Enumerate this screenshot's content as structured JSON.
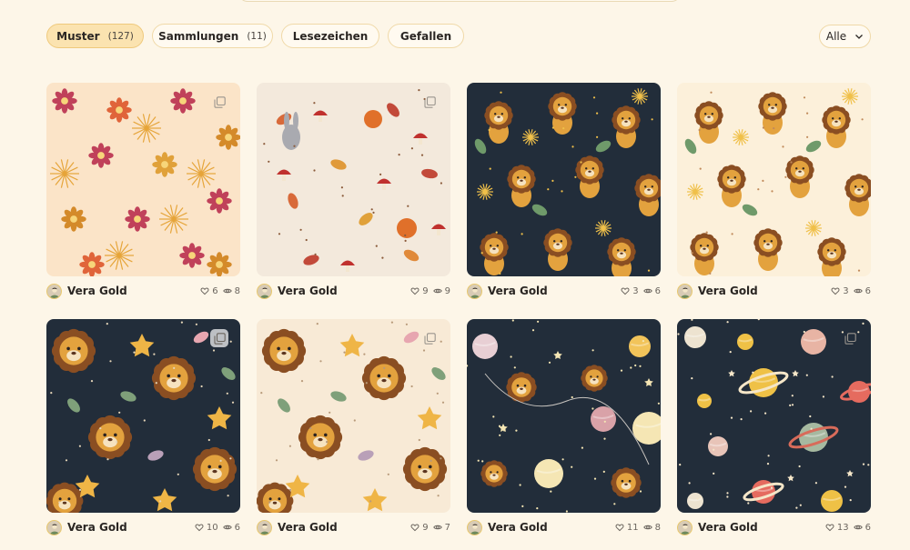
{
  "tabs": [
    {
      "label": "Muster",
      "count": "(127)",
      "active": true
    },
    {
      "label": "Sammlungen",
      "count": "(11)",
      "active": false
    },
    {
      "label": "Lesezeichen",
      "count": "",
      "active": false
    },
    {
      "label": "Gefallen",
      "count": "",
      "active": false
    }
  ],
  "filter": {
    "selected": "Alle",
    "icon": "chevron-down-icon"
  },
  "icons": {
    "like": "heart-icon",
    "views": "eye-icon",
    "collection": "stack-icon",
    "avatar": "avatar-icon"
  },
  "colors": {
    "background": "#fdf6e8",
    "tab_active": "#fbe3b0",
    "tab_border": "#f0d9a8",
    "navy": "#222d3a",
    "cream": "#f7ecd8",
    "lion": "#e0a13a"
  },
  "cards": [
    {
      "author": "Vera Gold",
      "likes": "6",
      "views": "8",
      "theme": "flowers",
      "collection_icon": "outline"
    },
    {
      "author": "Vera Gold",
      "likes": "9",
      "views": "9",
      "theme": "autumn-forest",
      "collection_icon": "outline"
    },
    {
      "author": "Vera Gold",
      "likes": "3",
      "views": "6",
      "theme": "lions-navy",
      "collection_icon": "none"
    },
    {
      "author": "Vera Gold",
      "likes": "3",
      "views": "6",
      "theme": "lions-cream",
      "collection_icon": "none"
    },
    {
      "author": "Vera Gold",
      "likes": "10",
      "views": "6",
      "theme": "lion-faces-navy",
      "collection_icon": "solid"
    },
    {
      "author": "Vera Gold",
      "likes": "9",
      "views": "7",
      "theme": "lion-faces-cream",
      "collection_icon": "outline"
    },
    {
      "author": "Vera Gold",
      "likes": "11",
      "views": "8",
      "theme": "space-lions",
      "collection_icon": "none"
    },
    {
      "author": "Vera Gold",
      "likes": "13",
      "views": "6",
      "theme": "planets",
      "collection_icon": "outline"
    }
  ]
}
